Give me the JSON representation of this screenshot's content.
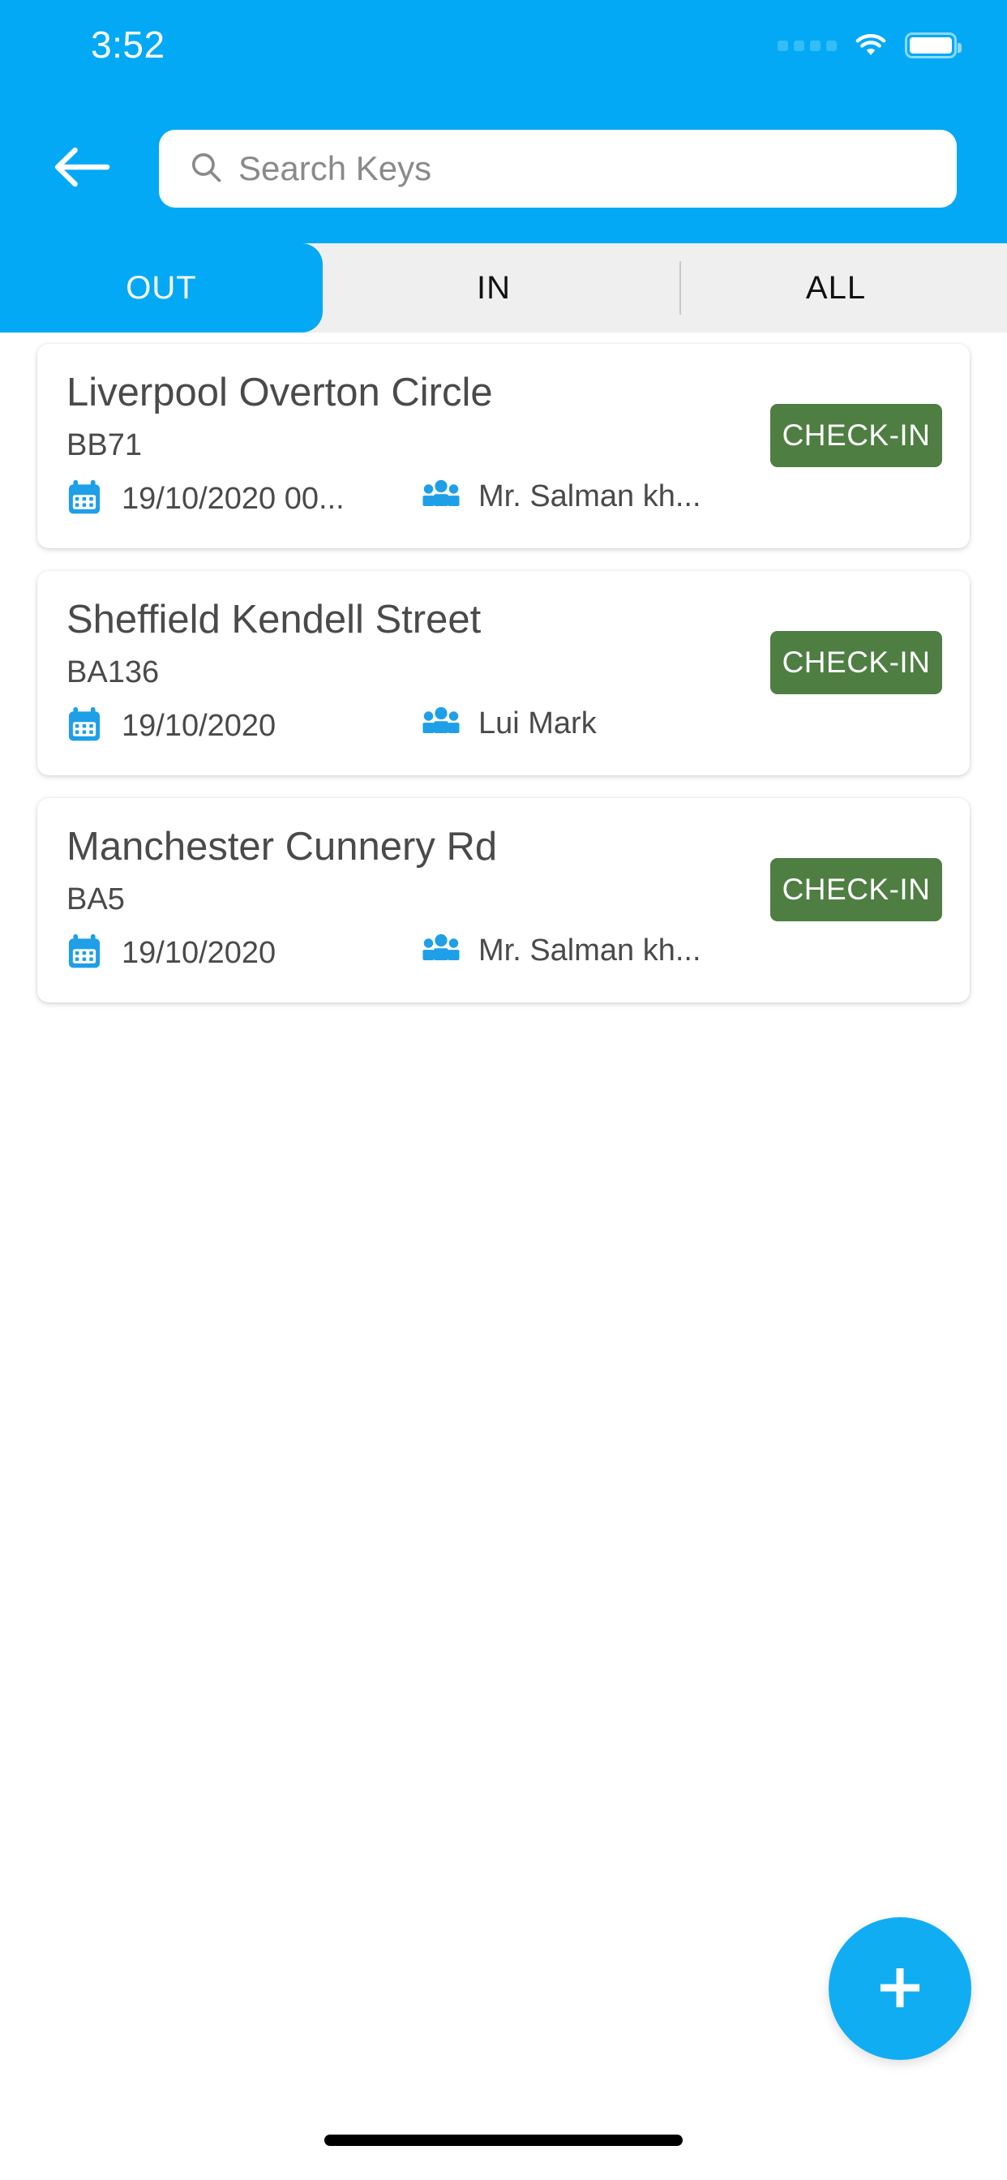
{
  "status_bar": {
    "time": "3:52",
    "signal_icon": "signal-dots-icon",
    "wifi_icon": "wifi-icon",
    "battery_icon": "battery-full-icon"
  },
  "header": {
    "accent_color": "#03A9F4",
    "back_icon": "back-arrow-icon",
    "search": {
      "icon": "search-icon",
      "placeholder": "Search Keys",
      "value": ""
    }
  },
  "tabs": {
    "active_index": 0,
    "items": [
      {
        "label": "OUT"
      },
      {
        "label": "IN"
      },
      {
        "label": "ALL"
      }
    ]
  },
  "list": {
    "date_icon": "calendar-icon",
    "user_icon": "people-group-icon",
    "action_label": "CHECK-IN",
    "action_color": "#4e7e42",
    "items": [
      {
        "title": "Liverpool Overton Circle",
        "code": "BB71",
        "date": "19/10/2020 00...",
        "user": "Mr. Salman kh...",
        "action": "CHECK-IN"
      },
      {
        "title": "Sheffield  Kendell Street",
        "code": "BA136",
        "date": "19/10/2020",
        "user": "Lui Mark",
        "action": "CHECK-IN"
      },
      {
        "title": "Manchester Cunnery Rd",
        "code": "BA5",
        "date": "19/10/2020",
        "user": "Mr. Salman kh...",
        "action": "CHECK-IN"
      }
    ]
  },
  "fab": {
    "icon": "plus-icon",
    "color": "#11ADF2"
  },
  "home_indicator": {
    "present": true
  }
}
